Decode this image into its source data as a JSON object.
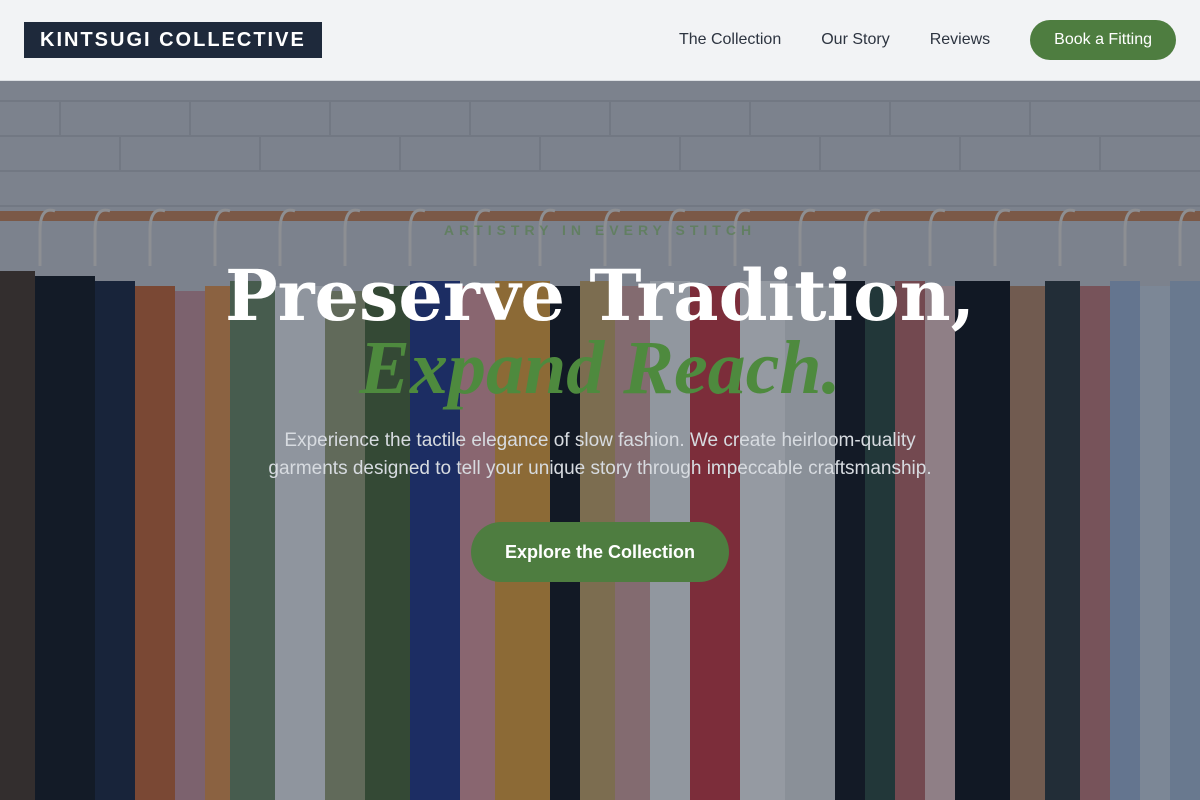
{
  "header": {
    "logo": "KINTSUGI COLLECTIVE",
    "nav": [
      {
        "label": "The Collection"
      },
      {
        "label": "Our Story"
      },
      {
        "label": "Reviews"
      }
    ],
    "cta_label": "Book a Fitting"
  },
  "hero": {
    "eyebrow": "ARTISTRY IN EVERY STITCH",
    "headline_line1": "Preserve Tradition,",
    "headline_line2": "Expand Reach.",
    "subtitle": "Experience the tactile elegance of slow fashion. We create heirloom-quality garments designed to tell your unique story through impeccable craftsmanship.",
    "button_label": "Explore the Collection",
    "background_image": "rack-of-clothes"
  },
  "colors": {
    "accent_green": "#4e7d40",
    "logo_navy": "#1e293b",
    "header_bg": "#f2f3f5"
  }
}
